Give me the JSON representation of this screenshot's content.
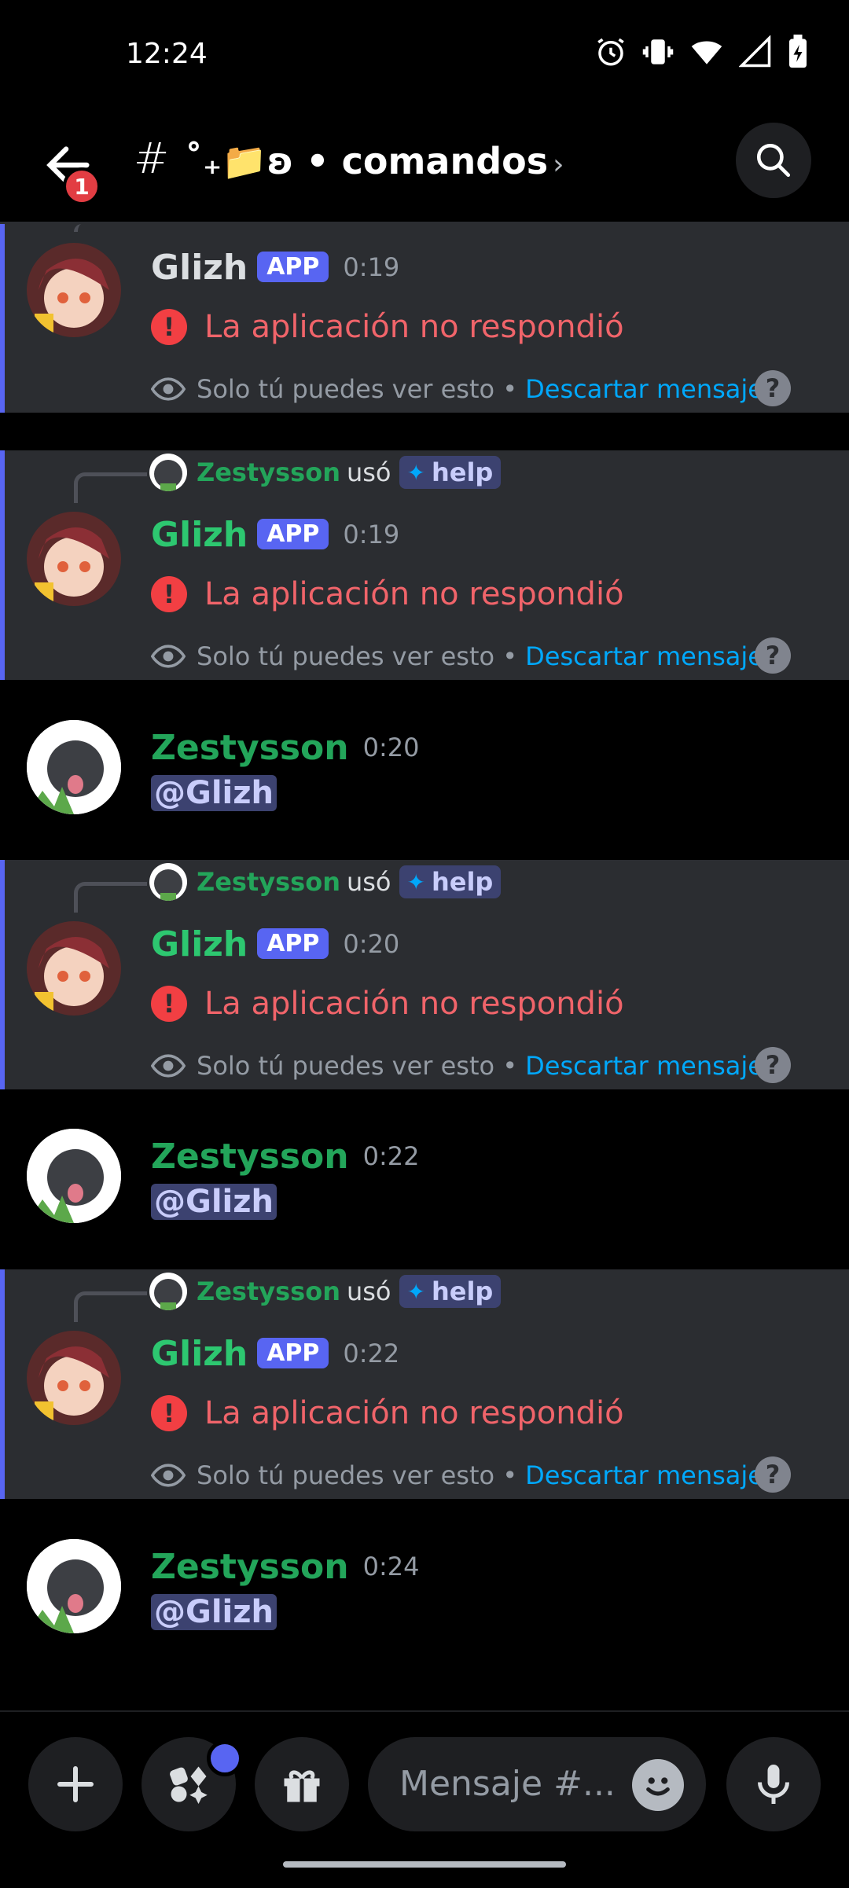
{
  "status_bar": {
    "time": "12:24"
  },
  "header": {
    "badge_count": "1",
    "hash": "#",
    "channel_name": "˚₊📁ʚ • comandos",
    "chevron": "›"
  },
  "messages": [
    {
      "type": "ephemeral",
      "author": "Glizh",
      "tag": "APP",
      "time": "0:19",
      "error": "La aplicación no respondió",
      "note": "Solo tú puedes ver esto •",
      "dismiss": "Descartar mensaje"
    },
    {
      "type": "ephemeral_reply",
      "reply_user": "Zestysson",
      "reply_used": "usó",
      "command": "help",
      "author": "Glizh",
      "tag": "APP",
      "time": "0:19",
      "error": "La aplicación no respondió",
      "note": "Solo tú puedes ver esto •",
      "dismiss": "Descartar mensaje"
    },
    {
      "type": "user",
      "author": "Zestysson",
      "time": "0:20",
      "mention": "@Glizh"
    },
    {
      "type": "ephemeral_reply",
      "reply_user": "Zestysson",
      "reply_used": "usó",
      "command": "help",
      "author": "Glizh",
      "tag": "APP",
      "time": "0:20",
      "error": "La aplicación no respondió",
      "note": "Solo tú puedes ver esto •",
      "dismiss": "Descartar mensaje"
    },
    {
      "type": "user",
      "author": "Zestysson",
      "time": "0:22",
      "mention": "@Glizh"
    },
    {
      "type": "ephemeral_reply",
      "reply_user": "Zestysson",
      "reply_used": "usó",
      "command": "help",
      "author": "Glizh",
      "tag": "APP",
      "time": "0:22",
      "error": "La aplicación no respondió",
      "note": "Solo tú puedes ver esto •",
      "dismiss": "Descartar mensaje"
    },
    {
      "type": "user",
      "author": "Zestysson",
      "time": "0:24",
      "mention": "@Glizh"
    }
  ],
  "composer": {
    "placeholder": "Mensaje #..."
  },
  "colors": {
    "accent": "#5865f2",
    "error": "#f0646a",
    "link": "#00a8fc",
    "user_green": "#23a55a",
    "app_green": "#2dc770"
  },
  "icons": [
    "back-arrow-icon",
    "search-icon",
    "plus-icon",
    "apps-icon",
    "gift-icon",
    "emoji-icon",
    "microphone-icon",
    "eye-icon",
    "error-icon",
    "help-icon"
  ]
}
